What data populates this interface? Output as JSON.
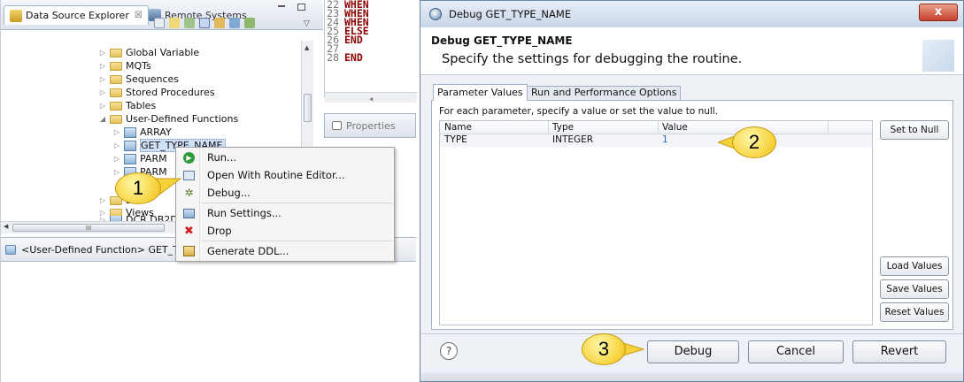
{
  "left_panel": {
    "tabs": [
      {
        "label": "Data Source Explorer",
        "close": "☒"
      },
      {
        "label": "Remote Systems"
      }
    ],
    "tree": [
      {
        "label": "Global Variable",
        "expanded": false,
        "kind": "folder"
      },
      {
        "label": "MQTs",
        "expanded": false,
        "kind": "folder"
      },
      {
        "label": "Sequences",
        "expanded": false,
        "kind": "folder"
      },
      {
        "label": "Stored Procedures",
        "expanded": false,
        "kind": "folder"
      },
      {
        "label": "Tables",
        "expanded": false,
        "kind": "folder"
      },
      {
        "label": "User-Defined Functions",
        "expanded": true,
        "kind": "folder"
      },
      {
        "label": "ARRAY",
        "kind": "function"
      },
      {
        "label": "GET_TYPE_NAME",
        "kind": "function",
        "selected": true
      },
      {
        "label": "PARM",
        "kind": "function"
      },
      {
        "label": "PARM",
        "kind": "function"
      },
      {
        "label": "Defi",
        "kind": "folder"
      },
      {
        "label": "Views",
        "kind": "folder"
      },
      {
        "label": "DCR DB2DD",
        "kind": "function"
      }
    ],
    "status_text": "<User-Defined Function> GET_T",
    "scroll_h_label": "III",
    "code_lines": [
      {
        "num": "22",
        "text": "WHEN"
      },
      {
        "num": "23",
        "text": "WHEN"
      },
      {
        "num": "24",
        "text": "WHEN"
      },
      {
        "num": "25",
        "text": "ELSE"
      },
      {
        "num": "26",
        "text": "END"
      },
      {
        "num": "27",
        "text": ""
      },
      {
        "num": "28",
        "text": "END"
      }
    ],
    "properties_label": "Properties",
    "context_menu": [
      {
        "label": "Run...",
        "icon": "run-icon"
      },
      {
        "label": "Open With Routine Editor...",
        "icon": "editor-icon"
      },
      {
        "label": "Debug...",
        "icon": "debug-icon"
      },
      {
        "label": "Run Settings...",
        "icon": "settings-icon"
      },
      {
        "label": "Drop",
        "icon": "drop-icon"
      },
      {
        "label": "Generate DDL...",
        "icon": "ddl-icon"
      }
    ]
  },
  "callouts": [
    "1",
    "2",
    "3"
  ],
  "dialog": {
    "window_title": "Debug GET_TYPE_NAME",
    "close_label": "x",
    "heading": "Debug GET_TYPE_NAME",
    "subheading": "Specify the settings for debugging the routine.",
    "tabs": [
      "Parameter Values",
      "Run and Performance Options"
    ],
    "instruction": "For each parameter, specify a value or set the value to null.",
    "columns": [
      "Name",
      "Type",
      "Value"
    ],
    "rows": [
      {
        "name": "TYPE",
        "type": "INTEGER",
        "value": "1"
      }
    ],
    "side_buttons": {
      "set_null": "Set to Null",
      "load": "Load Values",
      "save": "Save Values",
      "reset": "Reset Values"
    },
    "footer": {
      "help": "?",
      "debug": "Debug",
      "cancel": "Cancel",
      "revert": "Revert"
    }
  }
}
